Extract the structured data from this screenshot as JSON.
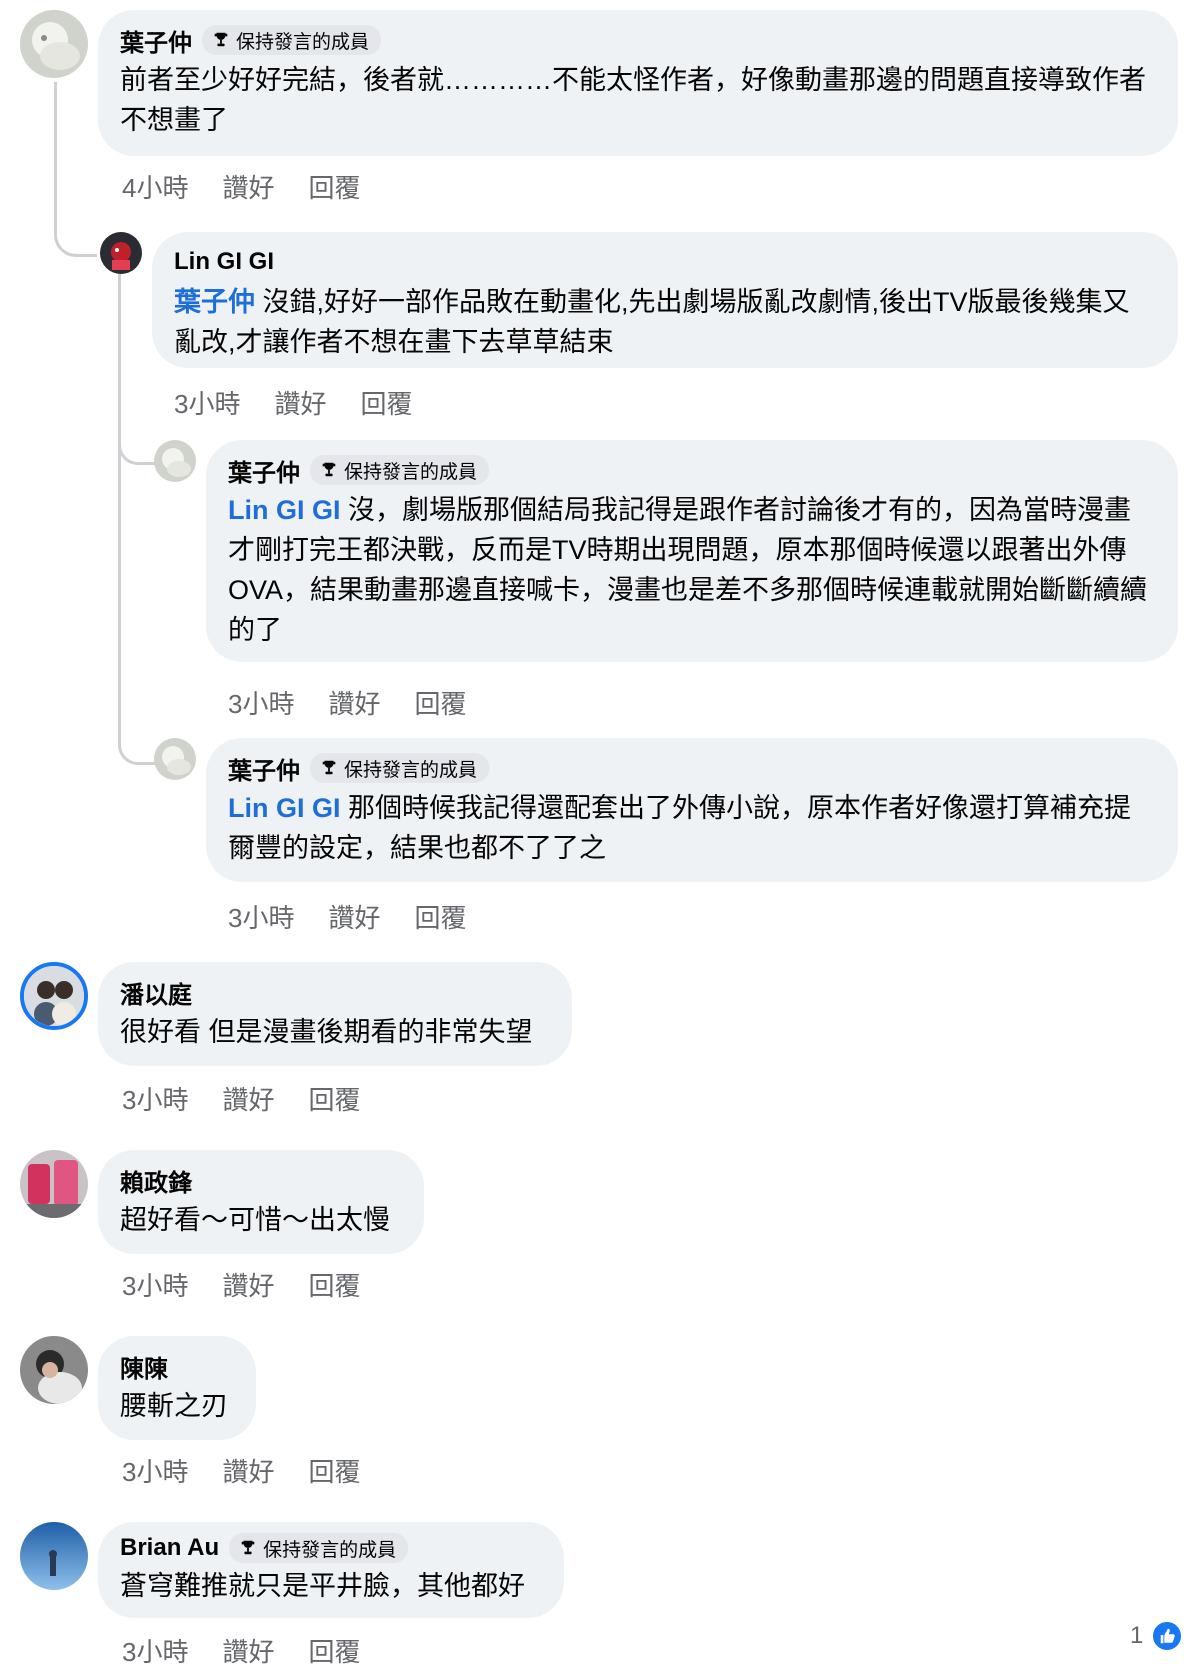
{
  "badge_label": "保持發言的成員",
  "colors": {
    "bubble_bg": "#eff2f5",
    "mention": "#1d6ed7",
    "meta_text": "#65676b",
    "like_blue": "#1877f2"
  },
  "comments": [
    {
      "name": "葉子仲",
      "has_badge": true,
      "text": "前者至少好好完結，後者就…………不能太怪作者，好像動畫那邊的問題直接導致作者不想畫了",
      "time": "4小時",
      "like": "讚好",
      "reply": "回覆"
    },
    {
      "name": "Lin GI GI",
      "has_badge": false,
      "mention": "葉子仲",
      "text": " 沒錯,好好一部作品敗在動畫化,先出劇場版亂改劇情,後出TV版最後幾集又亂改,才讓作者不想在畫下去草草結束",
      "time": "3小時",
      "like": "讚好",
      "reply": "回覆"
    },
    {
      "name": "葉子仲",
      "has_badge": true,
      "mention": "Lin GI GI",
      "text": " 沒，劇場版那個結局我記得是跟作者討論後才有的，因為當時漫畫才剛打完王都決戰，反而是TV時期出現問題，原本那個時候還以跟著出外傳OVA，結果動畫那邊直接喊卡，漫畫也是差不多那個時候連載就開始斷斷續續的了",
      "time": "3小時",
      "like": "讚好",
      "reply": "回覆"
    },
    {
      "name": "葉子仲",
      "has_badge": true,
      "mention": "Lin GI GI",
      "text": " 那個時候我記得還配套出了外傳小說，原本作者好像還打算補充提爾豐的設定，結果也都不了了之",
      "time": "3小時",
      "like": "讚好",
      "reply": "回覆"
    },
    {
      "name": "潘以庭",
      "has_badge": false,
      "text": "很好看 但是漫畫後期看的非常失望",
      "time": "3小時",
      "like": "讚好",
      "reply": "回覆"
    },
    {
      "name": "賴政鋒",
      "has_badge": false,
      "text": "超好看～可惜～出太慢",
      "time": "3小時",
      "like": "讚好",
      "reply": "回覆"
    },
    {
      "name": "陳陳",
      "has_badge": false,
      "text": "腰斬之刃",
      "time": "3小時",
      "like": "讚好",
      "reply": "回覆"
    },
    {
      "name": "Brian Au",
      "has_badge": true,
      "text": "蒼穹難推就只是平井臉，其他都好",
      "time": "3小時",
      "like": "讚好",
      "reply": "回覆"
    }
  ],
  "last_reaction_count": "1",
  "icons": {
    "badge": "trophy-icon",
    "reaction": "like-thumb-icon"
  }
}
